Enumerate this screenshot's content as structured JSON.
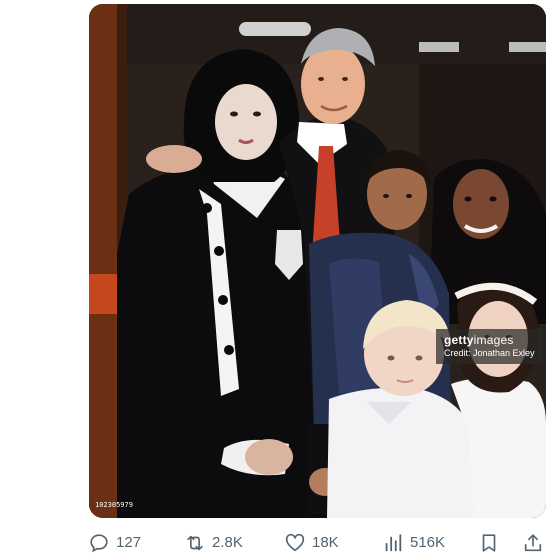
{
  "media": {
    "watermark_logo_bold": "getty",
    "watermark_logo_light": "images",
    "watermark_credit": "Credit: Jonathan Exley",
    "image_id": "102305979"
  },
  "actions": {
    "reply_count": "127",
    "retweet_count": "2.8K",
    "like_count": "18K",
    "view_count": "516K"
  },
  "icons": {
    "reply": "reply-icon",
    "retweet": "retweet-icon",
    "like": "heart-icon",
    "views": "views-icon",
    "bookmark": "bookmark-icon",
    "share": "share-icon"
  },
  "colors": {
    "action_gray": "#536471",
    "watermark_bg": "#282828"
  }
}
